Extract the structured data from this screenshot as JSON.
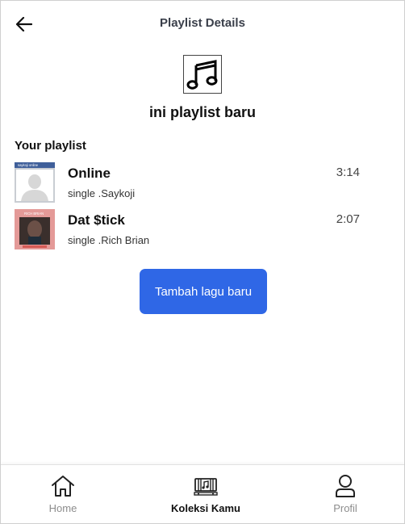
{
  "header": {
    "title": "Playlist Details",
    "back_icon": "arrow-left-icon"
  },
  "playlist": {
    "name": "ini playlist baru",
    "cover_icon": "music-note-icon"
  },
  "section": {
    "title": "Your playlist"
  },
  "songs": [
    {
      "title": "Online",
      "subtitle": "single .Saykoji",
      "duration": "3:14",
      "thumb_caption": "saykoji online"
    },
    {
      "title": "Dat $tick",
      "subtitle": "single .Rich Brian",
      "duration": "2:07",
      "thumb_caption": "RICH BRIAN"
    }
  ],
  "actions": {
    "add_song_label": "Tambah lagu baru",
    "button_color": "#2f67e6"
  },
  "nav": {
    "items": [
      {
        "label": "Home",
        "icon": "home-icon",
        "active": false
      },
      {
        "label": "Koleksi Kamu",
        "icon": "library-icon",
        "active": true
      },
      {
        "label": "Profil",
        "icon": "user-icon",
        "active": false
      }
    ]
  }
}
